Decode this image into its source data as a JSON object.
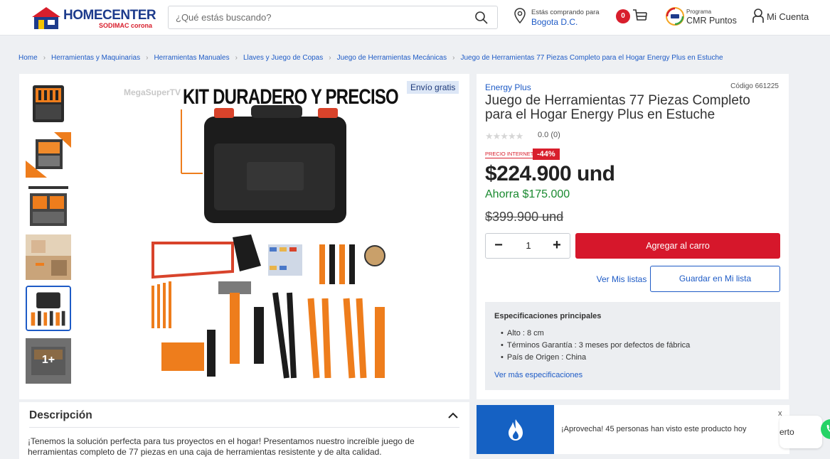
{
  "header": {
    "logo_text": "HOMECENTER",
    "logo_sub": "SODIMAC corona",
    "search_placeholder": "¿Qué estás buscando?",
    "location_label": "Estás comprando para",
    "location_city": "Bogota D.C.",
    "cart_count": "0",
    "cmr_small": "Programa",
    "cmr_label": "CMR Puntos",
    "account_label": "Mi Cuenta"
  },
  "breadcrumb": [
    "Home",
    "Herramientas y Maquinarias",
    "Herramientas Manuales",
    "Llaves y Juego de Copas",
    "Juego de Herramientas Mecánicas",
    "Juego de Herramientas 77 Piezas Completo para el Hogar Energy Plus en Estuche"
  ],
  "gallery": {
    "free_shipping": "Envío gratis",
    "image_headline": "KIT DURADERO Y PRECISO",
    "watermark": "MegaSuperTV",
    "thumb_more": "1+"
  },
  "product": {
    "brand": "Energy Plus",
    "code": "Código 661225",
    "title": "Juego de Herramientas 77 Piezas Completo para el Hogar Energy Plus en Estuche",
    "stars": "★★★★★",
    "rating": "0.0 (0)",
    "price_label": "PRECIO INTERNET",
    "discount": "-44%",
    "price": "$224.900 und",
    "savings": "Ahorra $175.000",
    "old_price": "$399.900 und",
    "quantity": "1",
    "add_to_cart": "Agregar al carro",
    "view_lists": "Ver Mis listas",
    "save_list": "Guardar en Mi lista"
  },
  "specs": {
    "title": "Especificaciones principales",
    "items": [
      "Alto : 8 cm",
      "Términos Garantía : 3 meses por defectos de fábrica",
      "País de Origen : China"
    ],
    "more": "Ver más especificaciones"
  },
  "description": {
    "title": "Descripción",
    "text": "¡Tenemos la solución perfecta para tus proyectos en el hogar! Presentamos nuestro increíble juego de herramientas completo de 77 piezas en una caja de herramientas resistente y de alta calidad."
  },
  "promo": {
    "text": "¡Aprovecha! 45 personas han visto este producto hoy",
    "close": "x"
  },
  "chat": {
    "label": "erto"
  },
  "colors": {
    "brand_blue": "#1e5bc6",
    "brand_red": "#d6172b",
    "savings_green": "#1a8a30",
    "promo_blue": "#1561c3"
  }
}
